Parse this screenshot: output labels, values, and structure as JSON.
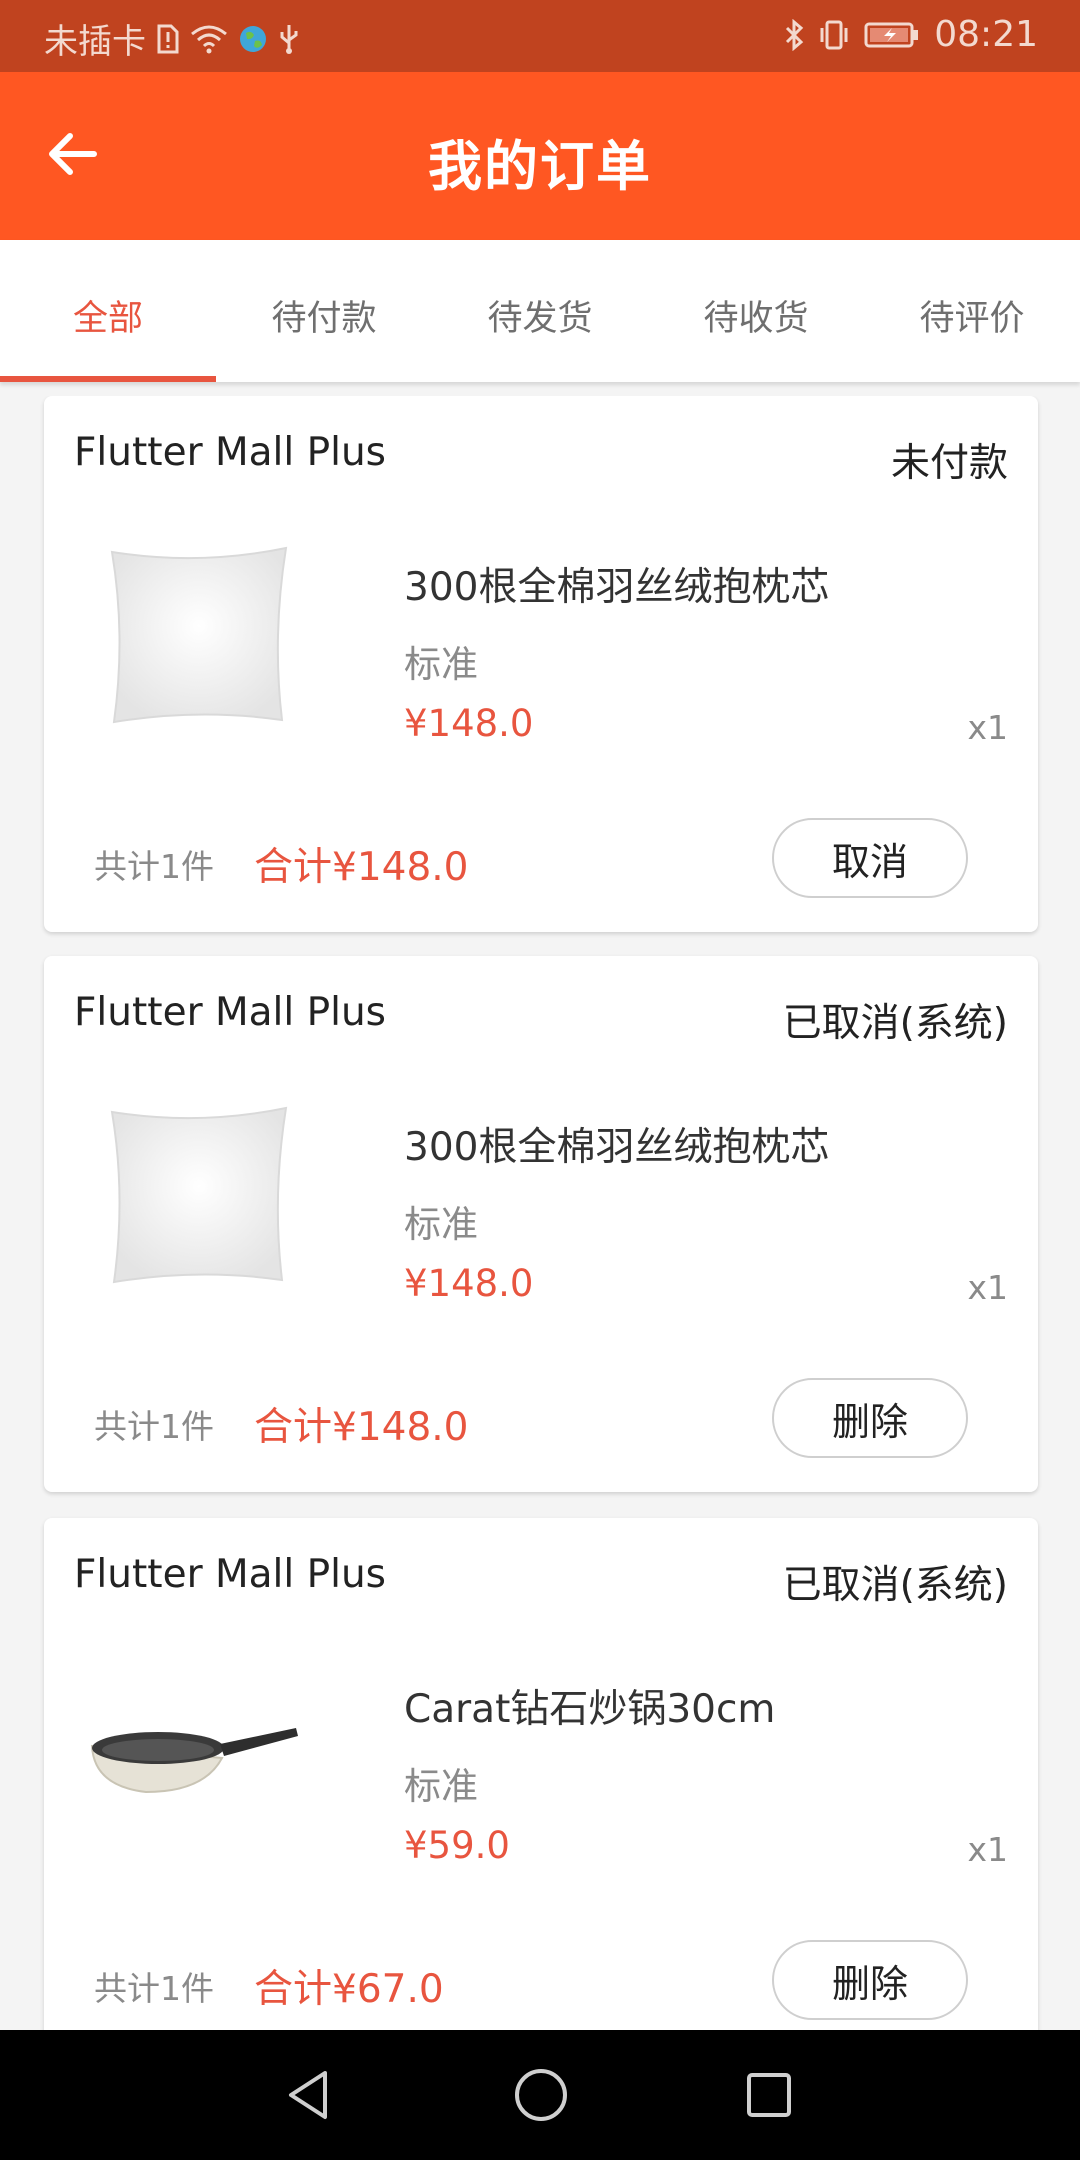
{
  "status_bar": {
    "carrier": "未插卡",
    "time": "08:21",
    "icons": [
      "sim-alert-icon",
      "wifi-icon",
      "globe-icon",
      "usb-icon",
      "bluetooth-icon",
      "vibrate-icon",
      "battery-charging-icon"
    ]
  },
  "app_bar": {
    "title": "我的订单",
    "back_icon": "arrow-left-icon"
  },
  "tabs": [
    {
      "label": "全部",
      "active": true
    },
    {
      "label": "待付款",
      "active": false
    },
    {
      "label": "待发货",
      "active": false
    },
    {
      "label": "待收货",
      "active": false
    },
    {
      "label": "待评价",
      "active": false
    }
  ],
  "orders": [
    {
      "shop": "Flutter Mall Plus",
      "status": "未付款",
      "item_name": "300根全棉羽丝绒抱枕芯",
      "spec": "标准",
      "price": "¥148.0",
      "qty": "x1",
      "count": "共计1件",
      "total": "合计¥148.0",
      "action": "取消",
      "image": "pillow"
    },
    {
      "shop": "Flutter Mall Plus",
      "status": "已取消(系统)",
      "item_name": "300根全棉羽丝绒抱枕芯",
      "spec": "标准",
      "price": "¥148.0",
      "qty": "x1",
      "count": "共计1件",
      "total": "合计¥148.0",
      "action": "删除",
      "image": "pillow"
    },
    {
      "shop": "Flutter Mall Plus",
      "status": "已取消(系统)",
      "item_name": "Carat钻石炒锅30cm",
      "spec": "标准",
      "price": "¥59.0",
      "qty": "x1",
      "count": "共计1件",
      "total": "合计¥67.0",
      "action": "删除",
      "image": "wok"
    }
  ],
  "colors": {
    "accent": "#e8553f",
    "app_bar": "#ff5722",
    "status_bar": "#c0431f"
  },
  "nav": {
    "icons": [
      "back-triangle-icon",
      "home-circle-icon",
      "recents-square-icon"
    ]
  }
}
